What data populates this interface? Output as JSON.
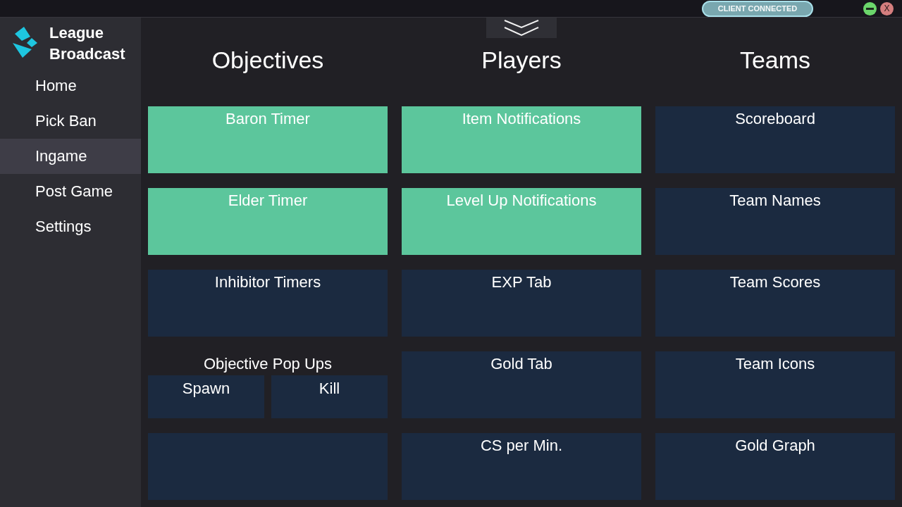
{
  "title_bar": {
    "status": "CLIENT CONNECTED",
    "close_label": "X"
  },
  "sidebar": {
    "app_name": "League Broadcast",
    "items": [
      {
        "label": "Home",
        "selected": false
      },
      {
        "label": "Pick Ban",
        "selected": false
      },
      {
        "label": "Ingame",
        "selected": true
      },
      {
        "label": "Post Game",
        "selected": false
      },
      {
        "label": "Settings",
        "selected": false
      }
    ]
  },
  "columns": [
    {
      "title": "Objectives",
      "tiles": [
        {
          "kind": "toggle",
          "label": "Baron Timer",
          "on": true
        },
        {
          "kind": "toggle",
          "label": "Elder Timer",
          "on": true
        },
        {
          "kind": "toggle",
          "label": "Inhibitor Timers",
          "on": false
        },
        {
          "kind": "group",
          "label": "Objective Pop Ups",
          "children": [
            {
              "label": "Spawn",
              "on": false
            },
            {
              "label": "Kill",
              "on": false
            }
          ]
        },
        {
          "kind": "toggle",
          "on": false
        }
      ]
    },
    {
      "title": "Players",
      "tiles": [
        {
          "kind": "toggle",
          "label": "Item Notifications",
          "on": true
        },
        {
          "kind": "toggle",
          "label": "Level Up Notifications",
          "on": true
        },
        {
          "kind": "toggle",
          "label": "EXP Tab",
          "on": false
        },
        {
          "kind": "toggle",
          "label": "Gold Tab",
          "on": false
        },
        {
          "kind": "toggle",
          "label": "CS per Min.",
          "on": false
        }
      ]
    },
    {
      "title": "Teams",
      "tiles": [
        {
          "kind": "toggle",
          "label": "Scoreboard",
          "on": false
        },
        {
          "kind": "toggle",
          "label": "Team Names",
          "on": false
        },
        {
          "kind": "toggle",
          "label": "Team Scores",
          "on": false
        },
        {
          "kind": "toggle",
          "label": "Team Icons",
          "on": false
        },
        {
          "kind": "toggle",
          "label": "Gold Graph",
          "on": false
        }
      ]
    }
  ]
}
